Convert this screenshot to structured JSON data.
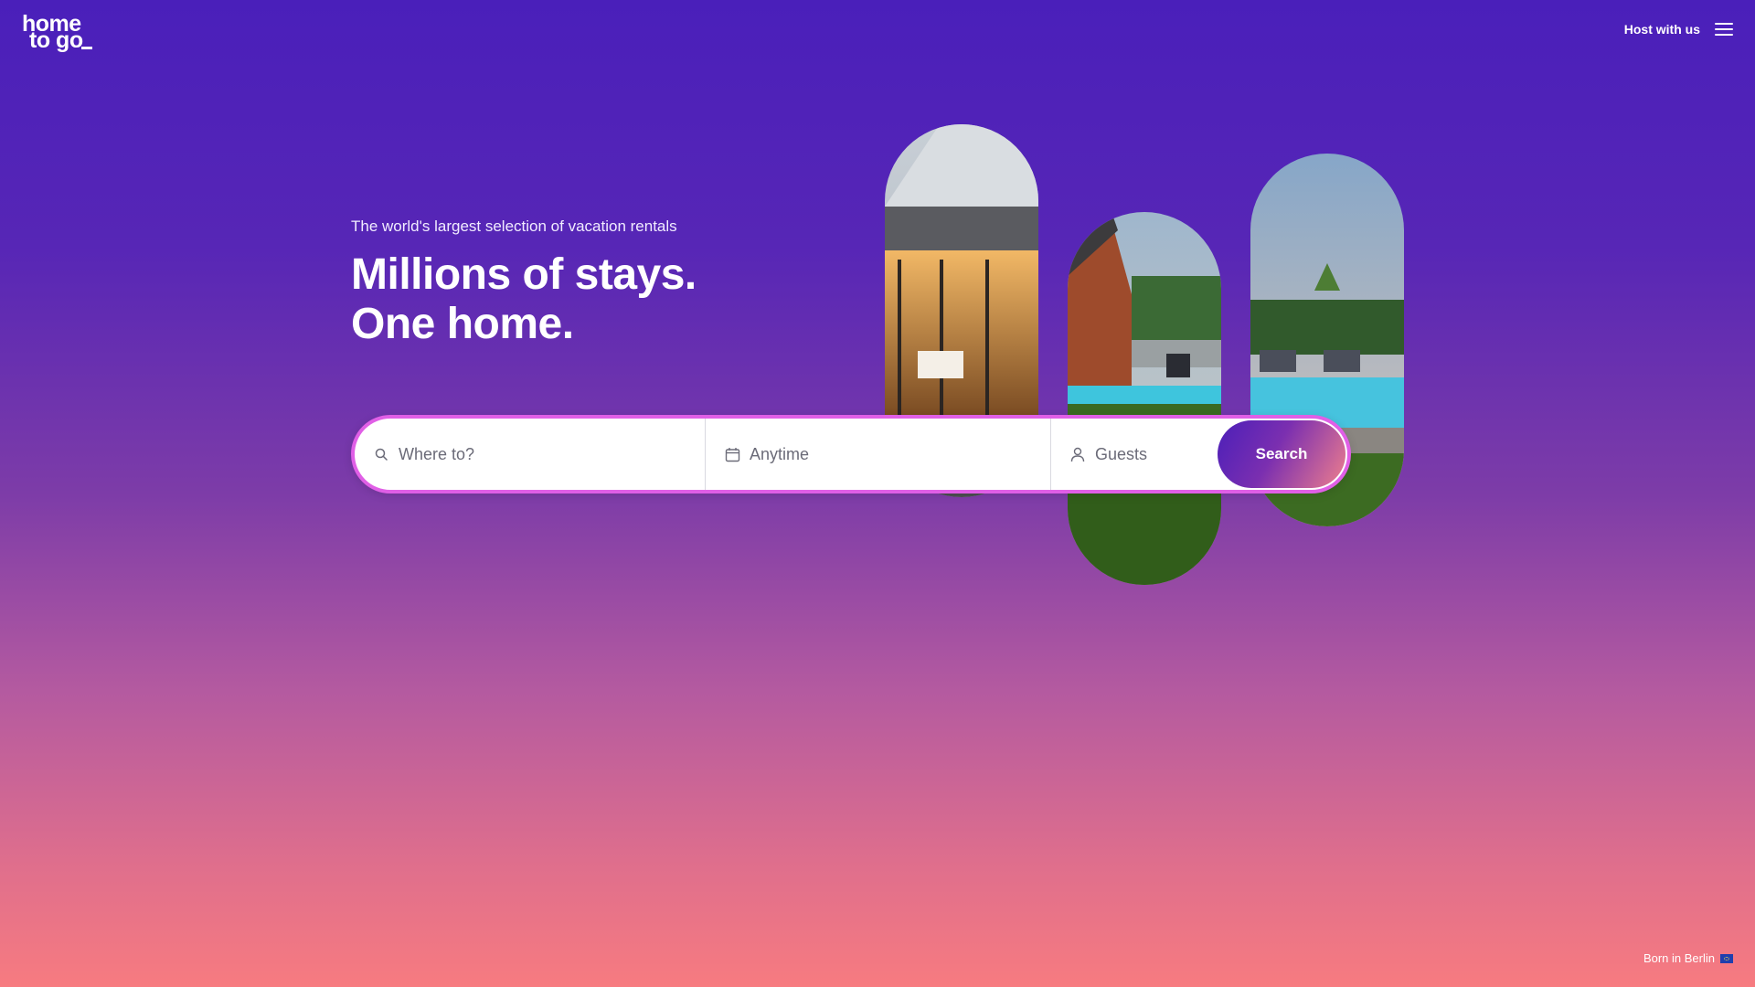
{
  "header": {
    "logo_line1": "home",
    "logo_line2": "to go",
    "host_link": "Host with us",
    "menu_icon": "hamburger-menu-icon"
  },
  "hero": {
    "subtitle": "The world's largest selection of vacation rentals",
    "title_line1": "Millions of stays.",
    "title_line2": "One home."
  },
  "search": {
    "destination_placeholder": "Where to?",
    "dates_placeholder": "Anytime",
    "guests_placeholder": "Guests",
    "button_label": "Search",
    "destination_icon": "search-icon",
    "dates_icon": "calendar-icon",
    "guests_icon": "person-icon"
  },
  "footer": {
    "note": "Born in Berlin",
    "flag_icon": "eu-flag-icon"
  },
  "colors": {
    "background_top": "#4a1fba",
    "background_bottom": "#f77b80",
    "search_border": "#e05fe6",
    "button_gradient_start": "#4b1fb9",
    "button_gradient_end": "#ee7f8d"
  }
}
